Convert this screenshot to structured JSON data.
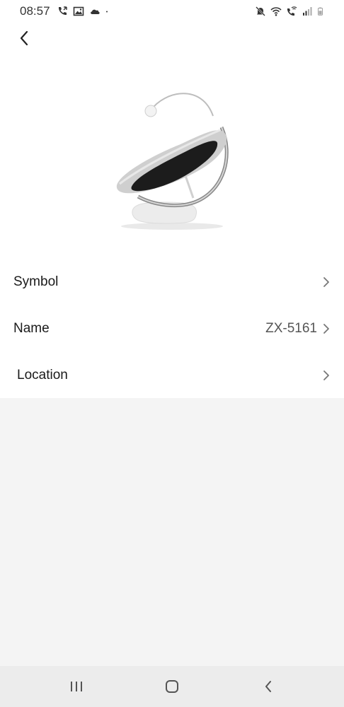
{
  "status_bar": {
    "time": "08:57",
    "left_icons": [
      "phone-call-icon",
      "gallery-icon",
      "cloud-icon",
      "dot-icon"
    ],
    "right_icons": [
      "mute-icon",
      "wifi-icon",
      "wifi-call-icon",
      "signal-icon",
      "battery-icon"
    ]
  },
  "header": {
    "back_icon": "chevron-left-icon"
  },
  "product": {
    "image": "baby-rocker-image"
  },
  "settings": {
    "rows": [
      {
        "label": "Symbol",
        "value": ""
      },
      {
        "label": "Name",
        "value": "ZX-5161"
      },
      {
        "label": "Location",
        "value": ""
      }
    ]
  },
  "nav_bar": {
    "icons": [
      "recent-apps-icon",
      "home-icon",
      "back-icon"
    ]
  },
  "colors": {
    "background": "#f4f4f4",
    "surface": "#ffffff",
    "nav_bar": "#ececec",
    "text": "#1a1a1a",
    "muted": "#555555"
  }
}
